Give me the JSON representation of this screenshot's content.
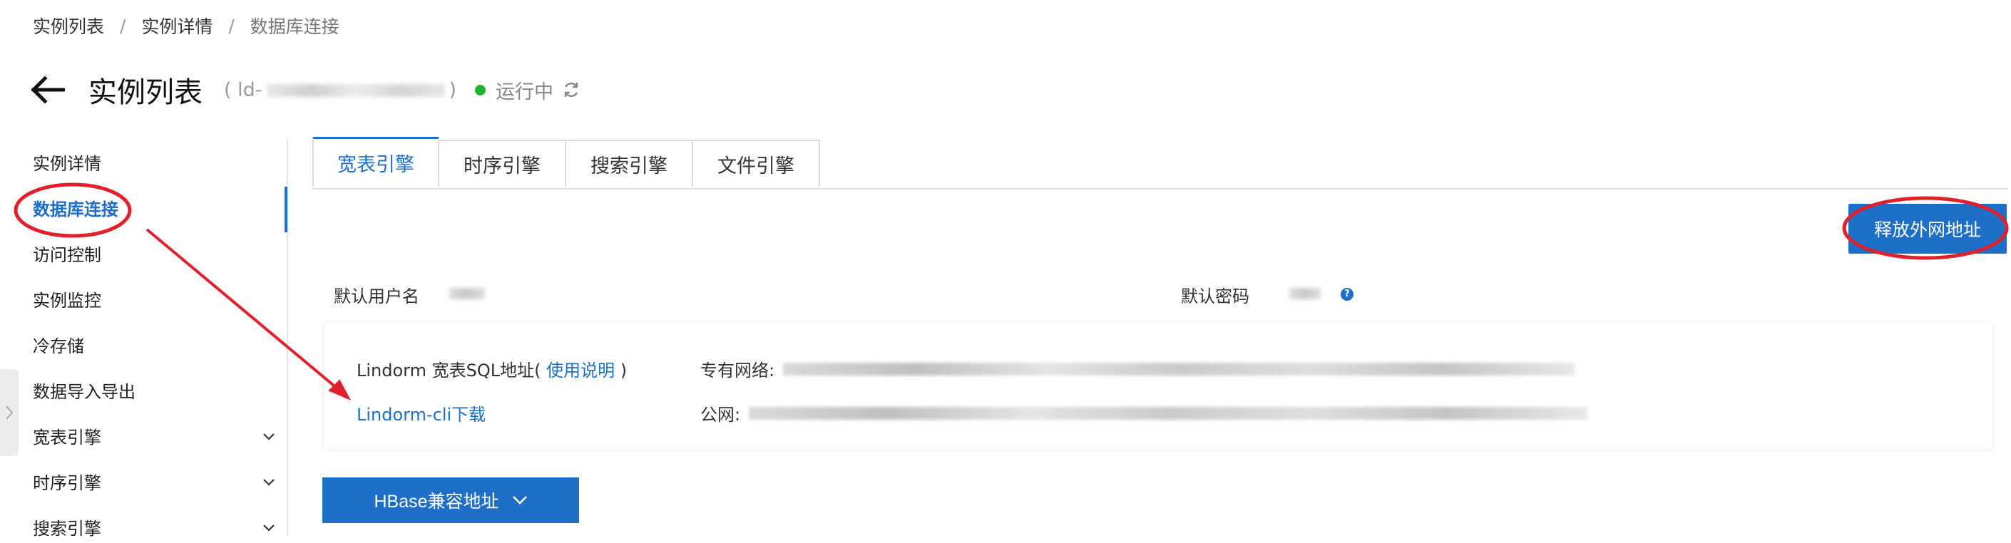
{
  "breadcrumb": {
    "items": [
      "实例列表",
      "实例详情",
      "数据库连接"
    ],
    "separator": "/"
  },
  "header": {
    "title": "实例列表",
    "instance_id_prefix": "( ld-",
    "instance_id_suffix": ")",
    "status": "运行中"
  },
  "sidebar": {
    "items": [
      {
        "label": "实例详情"
      },
      {
        "label": "数据库连接"
      },
      {
        "label": "访问控制"
      },
      {
        "label": "实例监控"
      },
      {
        "label": "冷存储"
      },
      {
        "label": "数据导入导出"
      },
      {
        "label": "宽表引擎"
      },
      {
        "label": "时序引擎"
      },
      {
        "label": "搜索引擎"
      }
    ],
    "active": "数据库连接"
  },
  "tabs": [
    {
      "label": "宽表引擎"
    },
    {
      "label": "时序引擎"
    },
    {
      "label": "搜索引擎"
    },
    {
      "label": "文件引擎"
    }
  ],
  "release_button": "释放外网地址",
  "credentials": {
    "username_label": "默认用户名",
    "password_label": "默认密码"
  },
  "address": {
    "label": "Lindorm 宽表SQL地址(",
    "usage_link": "使用说明",
    "label_close": ")",
    "cli_link": "Lindorm-cli下载",
    "private_label": "专有网络:",
    "public_label": "公网:"
  },
  "hbase_button": "HBase兼容地址",
  "colors": {
    "accent": "#1e6fc8",
    "status_running": "#1cb42f",
    "annotation_red": "#e0202a"
  },
  "icons": {
    "back": "arrow-left-icon",
    "refresh": "refresh-icon",
    "help": "question-icon",
    "chevron": "chevron-down-icon",
    "collapse": "chevron-right-icon"
  }
}
